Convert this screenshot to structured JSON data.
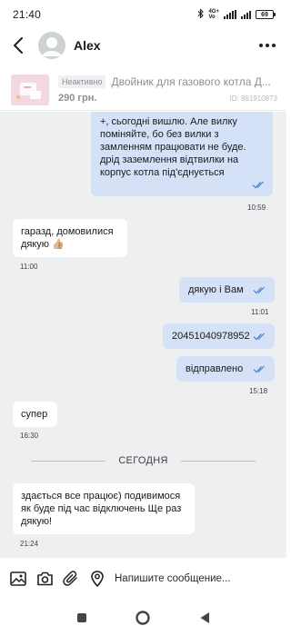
{
  "status_bar": {
    "time": "21:40",
    "battery": "69",
    "network": [
      "4G+",
      "Vo"
    ],
    "icons": [
      "bluetooth-icon",
      "signal-icon",
      "battery-icon"
    ]
  },
  "header": {
    "contact_name": "Alex",
    "icons": [
      "back-arrow-icon",
      "avatar",
      "more-dots-icon"
    ]
  },
  "product": {
    "status_badge": "Неактивно",
    "title": "Двойник для газового котла Д...",
    "price": "290 грн.",
    "listing_id": "ID: 861910873"
  },
  "messages": [
    {
      "direction": "out",
      "text": "+, сьогодні вишлю. Але вилку поміняйте, бо без вилки з замленням працювати не буде. дрід заземлення відтвилки на корпус котла під'єднується",
      "time": "10:59",
      "read": true
    },
    {
      "direction": "in",
      "text": "гаразд, домовилися дякую 👍🏼",
      "time": "11:00"
    },
    {
      "direction": "out",
      "text": "дякую і Вам",
      "time": "11:01",
      "read": true
    },
    {
      "direction": "out",
      "text": "20451040978952",
      "time": "",
      "read": true
    },
    {
      "direction": "out",
      "text": "відправлено",
      "time": "15:18",
      "read": true
    },
    {
      "direction": "in",
      "text": "супер",
      "time": "16:30"
    },
    {
      "direction": "in",
      "text": "здається все працює) подивимося як буде під час відключень  Ще раз дякую!",
      "time": "21:24"
    }
  ],
  "day_separator": "СЕГОДНЯ",
  "input_bar": {
    "placeholder": "Напишите сообщение...",
    "icons": [
      "image-icon",
      "camera-icon",
      "attach-icon",
      "location-icon"
    ]
  },
  "colors": {
    "chat_background": "#eeeff1",
    "incoming_bubble": "#ffffff",
    "outgoing_bubble": "#d5e1f7",
    "read_check": "#4a7bd8"
  },
  "nav_bar": {
    "icons": [
      "recent-apps-icon",
      "home-icon",
      "back-icon"
    ]
  }
}
